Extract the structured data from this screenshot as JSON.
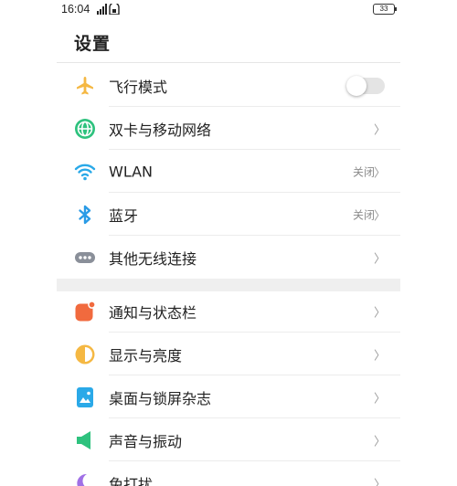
{
  "status_bar": {
    "time": "16:04",
    "battery": "33"
  },
  "header": {
    "title": "设置"
  },
  "colors": {
    "airplane": "#f5b843",
    "dual_sim": "#2ec27e",
    "wlan": "#2aa9e8",
    "bluetooth": "#2a9be6",
    "more_wireless": "#8a8f99",
    "notifications": "#f16a3e",
    "display": "#f5b843",
    "desktop": "#2aa9e8",
    "sound": "#2ec27e",
    "dnd": "#a070e6"
  },
  "group1": [
    {
      "label": "飞行模式",
      "icon": "airplane-icon",
      "control": "toggle",
      "toggle_on": false
    },
    {
      "label": "双卡与移动网络",
      "icon": "sim-card-icon",
      "control": "chevron"
    },
    {
      "label": "WLAN",
      "icon": "wifi-icon",
      "value": "关闭",
      "control": "chevron"
    },
    {
      "label": "蓝牙",
      "icon": "bluetooth-icon",
      "value": "关闭",
      "control": "chevron"
    },
    {
      "label": "其他无线连接",
      "icon": "more-connections-icon",
      "control": "chevron"
    }
  ],
  "group2": [
    {
      "label": "通知与状态栏",
      "icon": "notification-icon",
      "control": "chevron"
    },
    {
      "label": "显示与亮度",
      "icon": "brightness-icon",
      "control": "chevron"
    },
    {
      "label": "桌面与锁屏杂志",
      "icon": "wallpaper-icon",
      "control": "chevron"
    },
    {
      "label": "声音与振动",
      "icon": "speaker-icon",
      "control": "chevron"
    },
    {
      "label": "免打扰",
      "icon": "moon-icon",
      "control": "chevron"
    }
  ],
  "chevron_glyph": "〉"
}
